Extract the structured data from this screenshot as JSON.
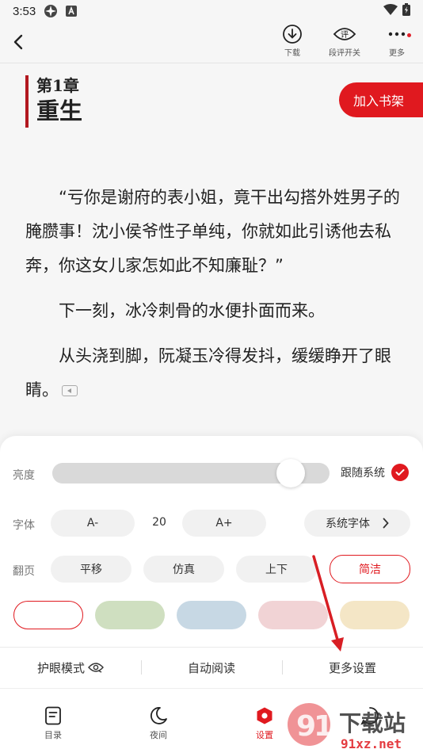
{
  "status_bar": {
    "time": "3:53"
  },
  "top_bar": {
    "actions": [
      {
        "label": "下载",
        "icon": "download-icon"
      },
      {
        "label": "段评开关",
        "icon": "comment-eye-icon"
      },
      {
        "label": "更多",
        "icon": "more-icon",
        "has_dot": true
      }
    ]
  },
  "chapter": {
    "number": "第1章",
    "title": "重生"
  },
  "add_to_shelf": "加入书架",
  "content": {
    "paragraphs": [
      "“亏你是谢府的表小姐，竟干出勾搭外姓男子的腌臜事！沈小侯爷性子单纯，你就如此引诱他去私奔，你这女儿家怎如此不知廉耻？”",
      "下一刻，冰冷刺骨的水便扑面而来。",
      "从头浇到脚，阮凝玉冷得发抖，缓缓睁开了眼睛。"
    ]
  },
  "settings": {
    "brightness": {
      "label": "亮度",
      "level": 0.9,
      "follow_system": "跟随系统",
      "follow_checked": true
    },
    "font": {
      "label": "字体",
      "decrease": "A-",
      "size": "20",
      "increase": "A+",
      "family": "系统字体"
    },
    "page_turn": {
      "label": "翻页",
      "options": [
        "平移",
        "仿真",
        "上下",
        "简洁"
      ],
      "selected": "简洁"
    },
    "themes": [
      "#ffffff",
      "#cfdfc0",
      "#c7d8e4",
      "#f1d3d5",
      "#f4e6c6"
    ],
    "selected_theme": 0,
    "bottom_actions": [
      "护眼模式",
      "自动阅读",
      "更多设置"
    ]
  },
  "nav": {
    "items": [
      {
        "label": "目录",
        "icon": "toc-icon"
      },
      {
        "label": "夜间",
        "icon": "moon-icon"
      },
      {
        "label": "设置",
        "icon": "settings-icon",
        "active": true
      },
      {
        "label": "",
        "icon": "comment-icon"
      }
    ]
  },
  "colors": {
    "accent": "#e0191f",
    "accent_dark": "#b2181f"
  },
  "watermark": {
    "main": "下载站",
    "sub": "91xz.net"
  }
}
